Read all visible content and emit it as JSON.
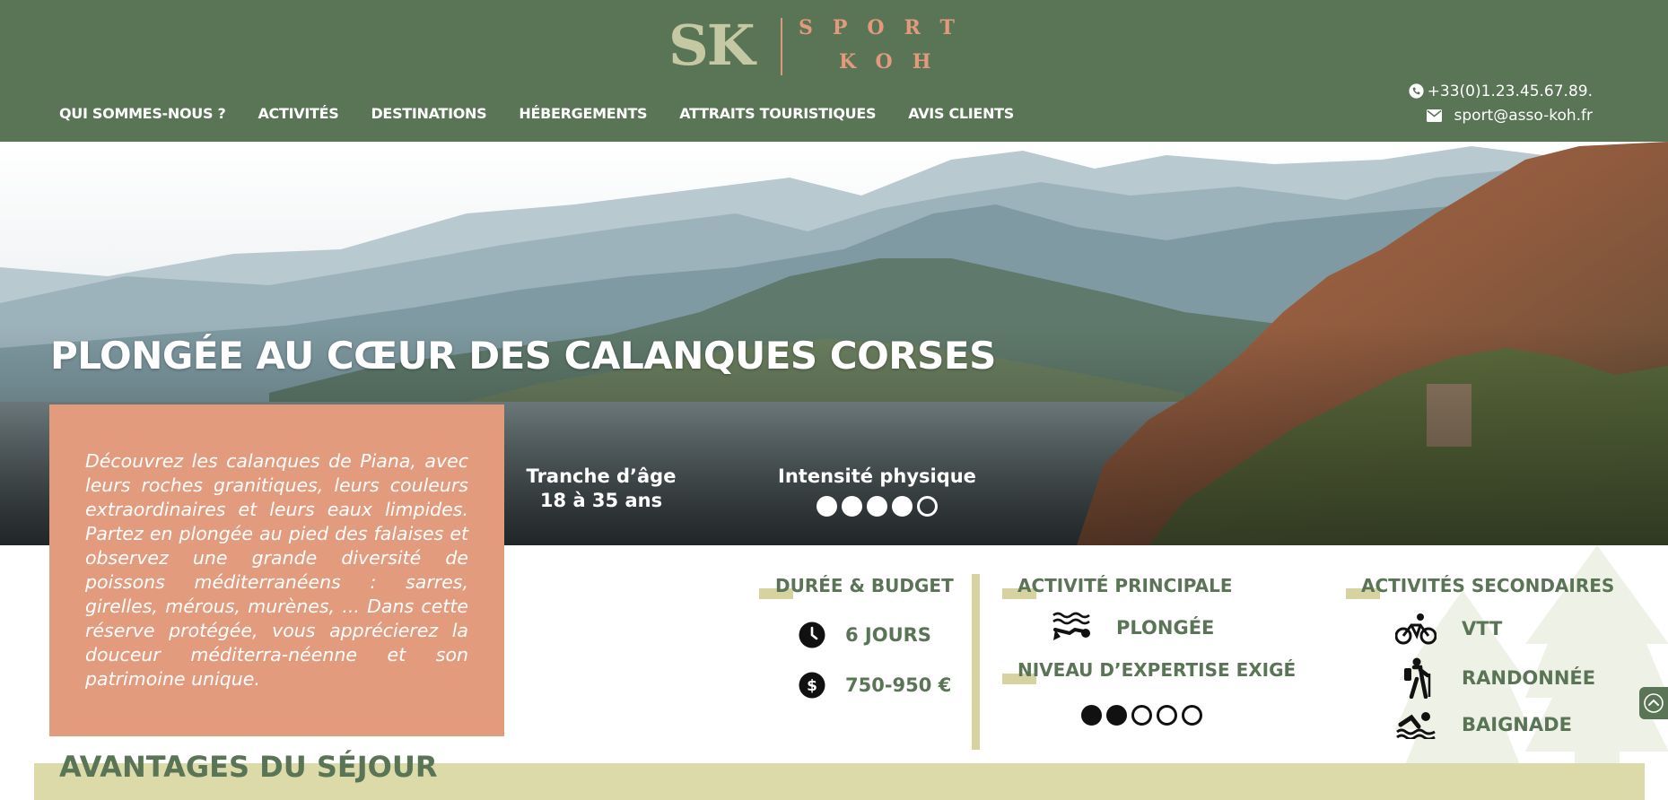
{
  "brand": {
    "logo_initials": "SK",
    "logo_line1": "SPORT",
    "logo_line2": "KOH"
  },
  "nav": {
    "items": [
      {
        "label": "QUI SOMMES-NOUS ?"
      },
      {
        "label": "ACTIVITÉS"
      },
      {
        "label": "DESTINATIONS"
      },
      {
        "label": "HÉBERGEMENTS"
      },
      {
        "label": "ATTRAITS TOURISTIQUES"
      },
      {
        "label": "AVIS CLIENTS"
      }
    ]
  },
  "contact": {
    "phone": "+33(0)1.23.45.67.89.",
    "email": "sport@asso-koh.fr",
    "phone_icon": "phone-icon",
    "email_icon": "envelope-icon"
  },
  "hero": {
    "title": "PLONGÉE AU CŒUR DES CALANQUES CORSES",
    "age_label": "Tranche d’âge",
    "age_value": "18 à 35 ans",
    "intensity_label": "Intensité physique",
    "intensity_level": 4,
    "intensity_max": 5
  },
  "description": "Découvrez les calanques de Piana, avec leurs roches granitiques, leurs couleurs extraordinaires et leurs eaux limpides. Partez en plongée au pied des falaises et observez une grande diversité de poissons méditerranéens : sarres, girelles, mérous, murènes, ... Dans cette réserve protégée, vous apprécierez la douceur méditerra-néenne et son patrimoine unique.",
  "duration_budget": {
    "title": "DURÉE & BUDGET",
    "duration": "6 JOURS",
    "budget": "750-950 €",
    "duration_icon": "clock-icon",
    "budget_icon": "dollar-icon"
  },
  "main_activity": {
    "title": "ACTIVITÉ PRINCIPALE",
    "activity": "PLONGÉE",
    "icon": "diving-icon"
  },
  "expertise": {
    "title": "NIVEAU D’EXPERTISE EXIGÉ",
    "level": 2,
    "max": 5
  },
  "secondary_activities": {
    "title": "ACTIVITÉS SECONDAIRES",
    "items": [
      {
        "label": "VTT",
        "icon": "bike-icon"
      },
      {
        "label": "RANDONNÉE",
        "icon": "hiking-icon"
      },
      {
        "label": "BAIGNADE",
        "icon": "swimming-icon"
      }
    ]
  },
  "avantages": {
    "title": "AVANTAGES DU SÉJOUR"
  },
  "colors": {
    "header_green": "#5a7456",
    "accent_salmon": "#e39b7e",
    "accent_khaki": "#d6d3a1"
  }
}
